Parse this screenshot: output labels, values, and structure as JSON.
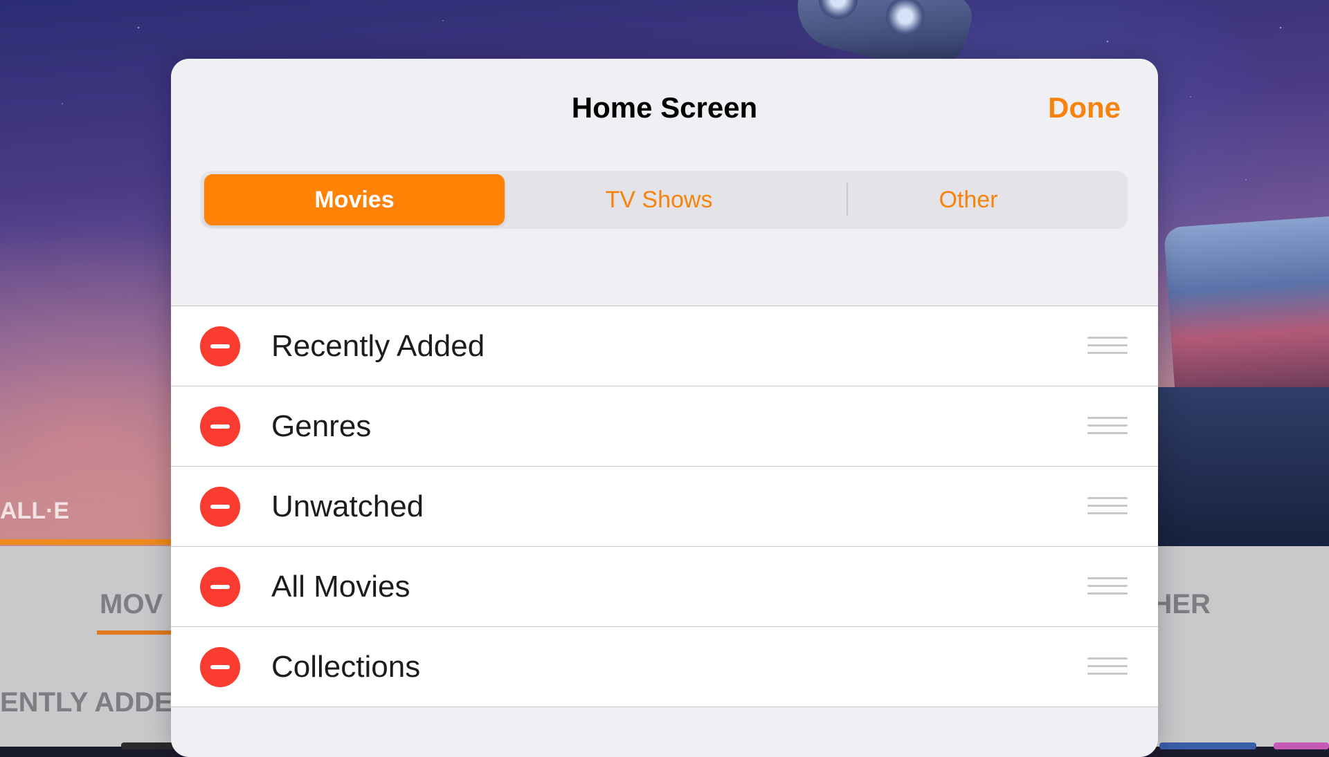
{
  "background": {
    "hero_title": "ALL·E",
    "tabs": {
      "left_label": "MOV",
      "right_label": "THER"
    },
    "section_title": "ENTLY ADDE"
  },
  "sheet": {
    "title": "Home Screen",
    "done_label": "Done",
    "segments": [
      {
        "label": "Movies",
        "selected": true
      },
      {
        "label": "TV Shows",
        "selected": false
      },
      {
        "label": "Other",
        "selected": false
      }
    ],
    "rows": [
      {
        "label": "Recently Added"
      },
      {
        "label": "Genres"
      },
      {
        "label": "Unwatched"
      },
      {
        "label": "All Movies"
      },
      {
        "label": "Collections"
      }
    ]
  },
  "icons": {
    "remove": "minus-circle-icon",
    "reorder": "drag-handle-icon"
  },
  "colors": {
    "accent": "#ff8205",
    "destructive": "#fa3b30",
    "sheet_background": "#efeff4"
  }
}
